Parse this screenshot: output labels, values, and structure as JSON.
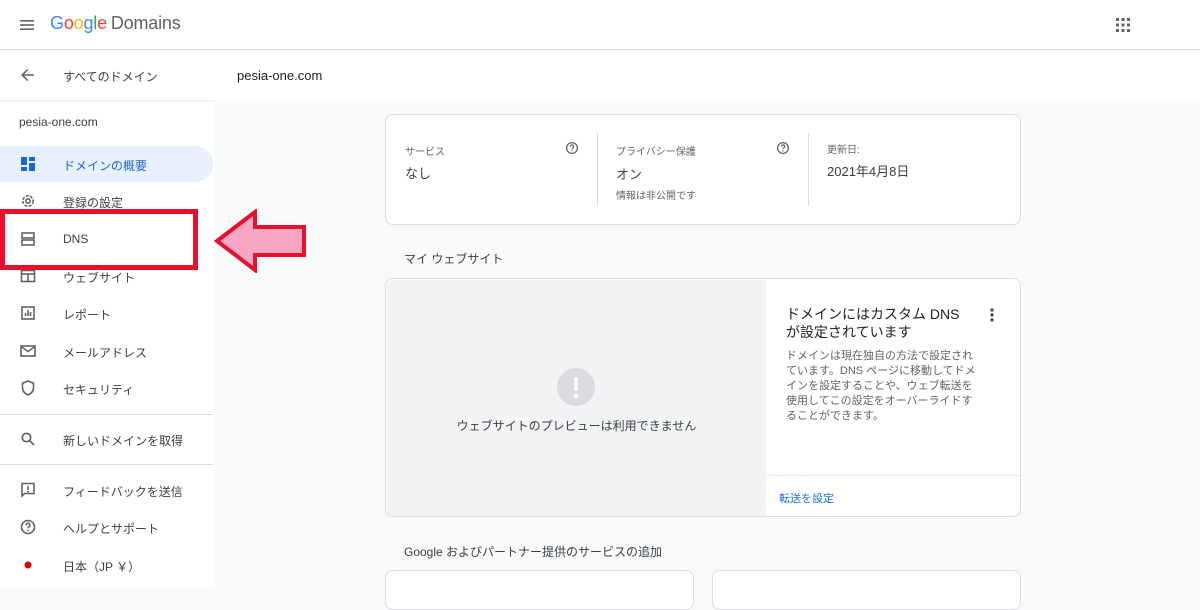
{
  "app": {
    "logo_letters": [
      "G",
      "o",
      "o",
      "g",
      "l",
      "e"
    ],
    "product": "Domains"
  },
  "sidebar": {
    "back_label": "すべてのドメイン",
    "domain": "pesia-one.com",
    "items": [
      {
        "label": "ドメインの概要",
        "icon": "dashboard-icon",
        "active": true
      },
      {
        "label": "登録の設定",
        "icon": "gear-icon"
      },
      {
        "label": "DNS",
        "icon": "dns-icon"
      },
      {
        "label": "ウェブサイト",
        "icon": "web-icon"
      },
      {
        "label": "レポート",
        "icon": "report-icon"
      },
      {
        "label": "メールアドレス",
        "icon": "email-icon"
      },
      {
        "label": "セキュリティ",
        "icon": "shield-icon"
      }
    ],
    "extra_items": [
      {
        "label": "新しいドメインを取得",
        "icon": "search-icon"
      },
      {
        "label": "フィードバックを送信",
        "icon": "feedback-icon"
      },
      {
        "label": "ヘルプとサポート",
        "icon": "help-icon"
      },
      {
        "label": "日本（JP ￥）",
        "icon": "japan-flag-icon"
      }
    ]
  },
  "main": {
    "title": "pesia-one.com",
    "summary": {
      "service": {
        "label": "サービス",
        "value": "なし"
      },
      "privacy": {
        "label": "プライバシー保護",
        "value": "オン",
        "sub": "情報は非公開です"
      },
      "updated": {
        "label": "更新日:",
        "value": "2021年4月8日"
      }
    },
    "website_section": {
      "title": "マイ ウェブサイト",
      "preview_unavailable": "ウェブサイトのプレビューは利用できません",
      "info_title": "ドメインにはカスタム DNS が設定されています",
      "info_body": "ドメインは現在独自の方法で設定されています。DNS ページに移動してドメインを設定することや、ウェブ転送を使用してこの設定をオーバーライドすることができます。",
      "forward_link": "転送を設定"
    },
    "partners_section": {
      "title": "Google およびパートナー提供のサービスの追加"
    }
  },
  "colors": {
    "highlight": "#e8112d",
    "arrow_fill": "#f7a6c4",
    "active_bg": "#e8f0fe",
    "link": "#1a73e8"
  }
}
